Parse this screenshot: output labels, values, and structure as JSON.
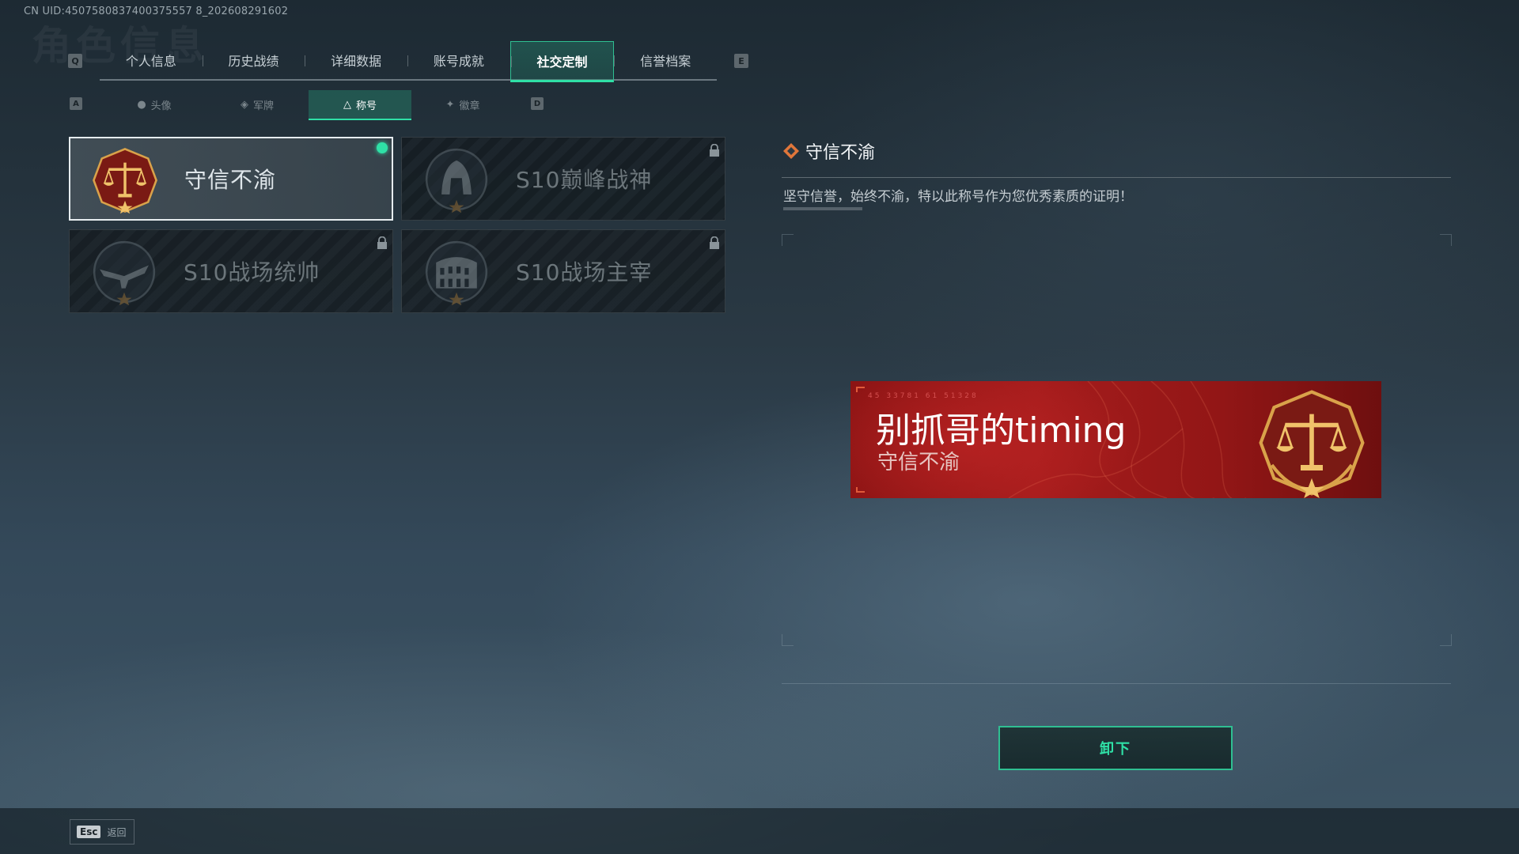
{
  "uid": "CN UID:4507580837400375557 8_202608291602",
  "watermark": "角色信息",
  "keys": {
    "prev_main": "Q",
    "next_main": "E",
    "prev_sub": "A",
    "next_sub": "D"
  },
  "main_tabs": [
    {
      "label": "个人信息"
    },
    {
      "label": "历史战绩"
    },
    {
      "label": "详细数据"
    },
    {
      "label": "账号成就"
    },
    {
      "label": "社交定制",
      "active": true
    },
    {
      "label": "信誉档案"
    }
  ],
  "sub_tabs": [
    {
      "label": "头像",
      "icon": "person-icon"
    },
    {
      "label": "军牌",
      "icon": "dogtag-icon"
    },
    {
      "label": "称号",
      "icon": "triangle-icon",
      "active": true
    },
    {
      "label": "徽章",
      "icon": "emblem-icon"
    }
  ],
  "cards": [
    {
      "title": "守信不渝",
      "selected": true,
      "equipped": true,
      "locked": false,
      "icon": "scales-emblem-icon"
    },
    {
      "title": "S10巅峰战神",
      "selected": false,
      "locked": true,
      "icon": "helmet-emblem-icon"
    },
    {
      "title": "S10战场统帅",
      "selected": false,
      "locked": true,
      "icon": "aircraft-emblem-icon"
    },
    {
      "title": "S10战场主宰",
      "selected": false,
      "locked": true,
      "icon": "colosseum-emblem-icon"
    }
  ],
  "detail": {
    "title": "守信不渝",
    "description": "坚守信誉，始终不渝，特以此称号作为您优秀素质的证明！"
  },
  "banner": {
    "player_name": "别抓哥的timing",
    "title": "守信不渝",
    "code": "45 33781  61 51328"
  },
  "actions": {
    "unequip": "卸下"
  },
  "footer": {
    "esc_key": "Esc",
    "back_label": "返回"
  },
  "colors": {
    "accent": "#2fe0a6",
    "banner_red": "#a51c1c",
    "gold": "#d9a24a"
  }
}
